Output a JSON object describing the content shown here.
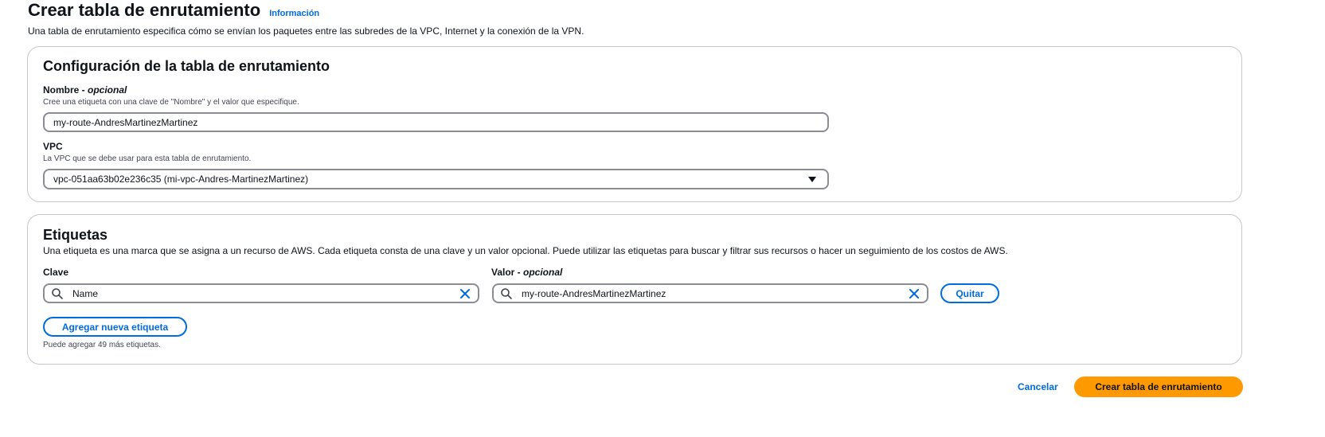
{
  "header": {
    "title": "Crear tabla de enrutamiento",
    "info_link": "Información",
    "description": "Una tabla de enrutamiento especifica cómo se envían los paquetes entre las subredes de la VPC, Internet y la conexión de la VPN."
  },
  "config": {
    "title": "Configuración de la tabla de enrutamiento",
    "name_label": "Nombre - ",
    "name_optional": "opcional",
    "name_hint": "Cree una etiqueta con una clave de \"Nombre\" y el valor que especifique.",
    "name_value": "my-route-AndresMartinezMartinez",
    "vpc_label": "VPC",
    "vpc_hint": "La VPC que se debe usar para esta tabla de enrutamiento.",
    "vpc_value": "vpc-051aa63b02e236c35 (mi-vpc-Andres-MartinezMartinez)"
  },
  "tags": {
    "title": "Etiquetas",
    "description": "Una etiqueta es una marca que se asigna a un recurso de AWS. Cada etiqueta consta de una clave y un valor opcional. Puede utilizar las etiquetas para buscar y filtrar sus recursos o hacer un seguimiento de los costos de AWS.",
    "key_label": "Clave",
    "value_label": "Valor - ",
    "value_optional": "opcional",
    "rows": [
      {
        "key": "Name",
        "value": "my-route-AndresMartinezMartinez"
      }
    ],
    "remove_button": "Quitar",
    "add_button": "Agregar nueva etiqueta",
    "limit_note": "Puede agregar 49 más etiquetas."
  },
  "footer": {
    "cancel": "Cancelar",
    "submit": "Crear tabla de enrutamiento"
  },
  "colors": {
    "link": "#006ce0",
    "primary": "#ff9900",
    "border": "#8c8c94"
  },
  "icons": [
    "search-icon",
    "clear-icon",
    "caret-down-icon"
  ]
}
